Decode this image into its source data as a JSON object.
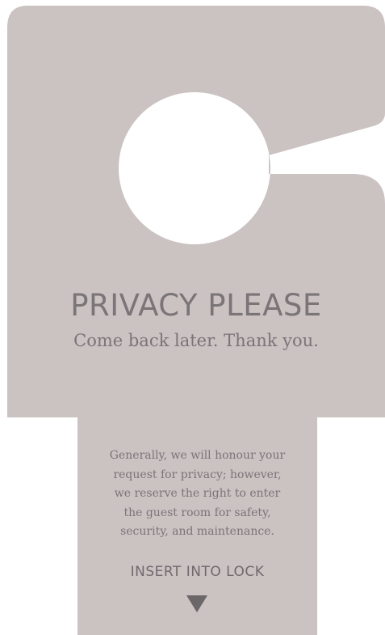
{
  "colors": {
    "card": "#cbc2c2",
    "text": "#7a7577",
    "arrow": "#6b6668",
    "background": "#ffffff"
  },
  "sign": {
    "title": "PRIVACY PLEASE",
    "subtitle": "Come back later. Thank you.",
    "policy_lines": [
      "Generally, we will honour your",
      "request for privacy; however,",
      "we reserve the right to enter",
      "the guest room for safety,",
      "security, and maintenance."
    ],
    "insert_label": "INSERT INTO LOCK",
    "arrow_icon": "triangle-down-icon"
  }
}
